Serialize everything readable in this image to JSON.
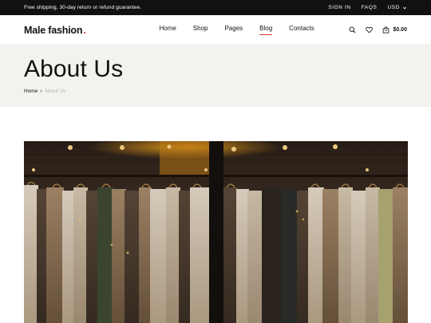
{
  "topbar": {
    "promo": "Free shipping, 30-day return or refund guarantee.",
    "sign_in": "SIGN IN",
    "faqs": "FAQS",
    "currency": "USD"
  },
  "header": {
    "logo_text": "Male fashion",
    "logo_dot": ".",
    "nav": [
      {
        "label": "Home"
      },
      {
        "label": "Shop"
      },
      {
        "label": "Pages"
      },
      {
        "label": "Blog",
        "active": true
      },
      {
        "label": "Contacts"
      }
    ],
    "cart_total": "$0.00"
  },
  "hero": {
    "title": "About Us",
    "breadcrumb_home": "Home",
    "breadcrumb_separator": "›",
    "breadcrumb_current": "About Us"
  },
  "colors": {
    "accent": "#e53637",
    "topbar_bg": "#111111",
    "hero_bg": "#f3f2ee",
    "muted": "#b7b7b7"
  },
  "icons": [
    "chevron-down-icon",
    "search-icon",
    "heart-icon",
    "bag-icon",
    "chevron-right-icon"
  ]
}
